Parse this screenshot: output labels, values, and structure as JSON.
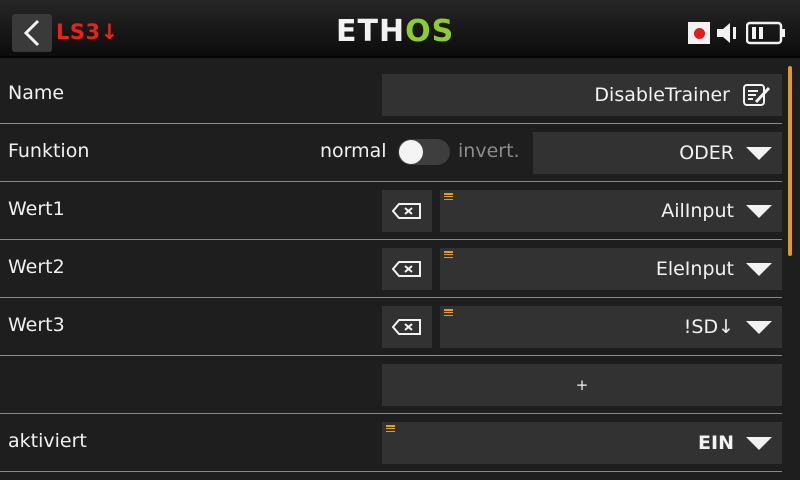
{
  "header": {
    "title": "LS3↓",
    "logo_part1": "ETH",
    "logo_part2": "OS"
  },
  "colors": {
    "accent": "#8fcc2c",
    "title": "#e8231a",
    "scroll": "#e39a22"
  },
  "form": {
    "name": {
      "label": "Name",
      "value": "DisableTrainer"
    },
    "funktion": {
      "label": "Funktion",
      "normal_label": "normal",
      "invert_label": "invert.",
      "value": "ODER"
    },
    "wert1": {
      "label": "Wert1",
      "value": "AilInput"
    },
    "wert2": {
      "label": "Wert2",
      "value": "EleInput"
    },
    "wert3": {
      "label": "Wert3",
      "value": "!SD↓"
    },
    "add_label": "+",
    "aktiviert": {
      "label": "aktiviert",
      "value": "EIN"
    }
  }
}
